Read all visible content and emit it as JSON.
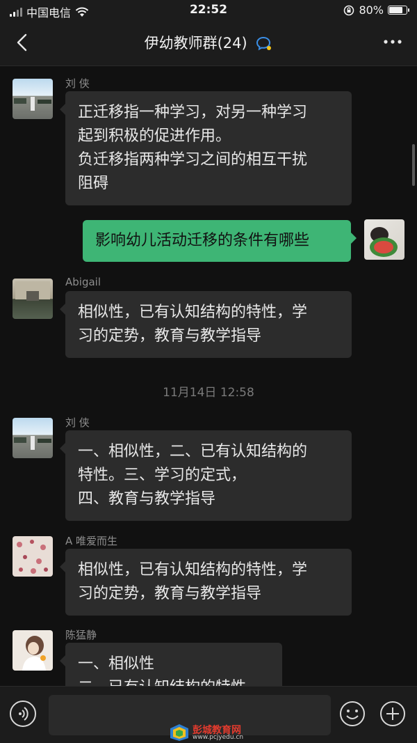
{
  "status_bar": {
    "carrier": "中国电信",
    "time": "22:52",
    "battery": "80%",
    "battery_level": 0.8
  },
  "nav": {
    "title": "伊幼教师群(24)"
  },
  "messages": [
    {
      "sender": "刘 侠",
      "text": "正迁移指一种学习，对另一种学习\n起到积极的促进作用。\n负迁移指两种学习之间的相互干扰\n阻碍"
    },
    {
      "text": "影响幼儿活动迁移的条件有哪些"
    },
    {
      "sender": "Abigail",
      "text": "相似性，已有认知结构的特性，学\n习的定势，教育与教学指导"
    },
    {
      "sender": "刘 侠",
      "text": "一、相似性，二、已有认知结构的\n特性。三、学习的定式，\n四、教育与教学指导"
    },
    {
      "sender": "A  唯爱而生",
      "text": "相似性，已有认知结构的特性，学\n习的定势，教育与教学指导"
    },
    {
      "sender": "陈猛静",
      "text": "一、相似性\n二、已有认知结构的特性"
    }
  ],
  "timestamp": "11月14日 12:58",
  "watermark": {
    "name": "彭城教育网",
    "url": "www.pcjyedu.cn"
  }
}
